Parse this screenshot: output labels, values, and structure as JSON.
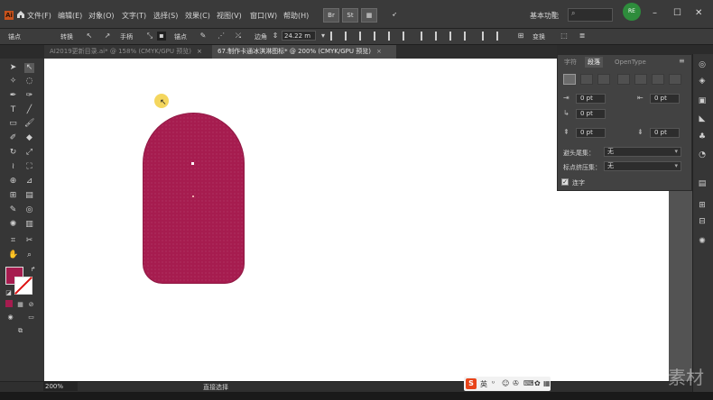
{
  "menubar": {
    "logo": "Ai",
    "items": [
      "文件(F)",
      "编辑(E)",
      "对象(O)",
      "文字(T)",
      "选择(S)",
      "效果(C)",
      "视图(V)",
      "窗口(W)",
      "帮助(H)"
    ],
    "bridge_icon": "Br",
    "stock_icon": "St",
    "workspace": "基本功能",
    "profile_label": "RE"
  },
  "control": {
    "label_anchor": "锚点",
    "label_convert": "转换",
    "label_handle": "手柄",
    "label_anchor_pt": "锚点",
    "label_corner": "边角",
    "corner_radius": "24.22 m",
    "label_transform": "变换"
  },
  "tabs": [
    {
      "label": "AI2019更新目录.ai* @ 158% (CMYK/GPU 预览)",
      "close": "×"
    },
    {
      "label": "67.制作卡通冰淇淋图标* @ 200% (CMYK/GPU 预览)",
      "close": "×"
    }
  ],
  "panel": {
    "tab_character": "字符",
    "tab_paragraph": "段落",
    "tab_opentype": "OpenType",
    "left_indent": "0 pt",
    "right_indent": "0 pt",
    "first_line_indent": "0 pt",
    "space_before": "0 pt",
    "space_after": "0 pt",
    "kinsoku_label": "避头尾集：",
    "kinsoku_value": "无",
    "mojikumi_label": "标点挤压集：",
    "mojikumi_value": "无",
    "hyphenate_label": "连字"
  },
  "status": {
    "zoom": "200%",
    "tool": "直接选择"
  },
  "ime": {
    "logo": "S",
    "lang": "英"
  },
  "watermark": "素材",
  "colors": {
    "shape_fill": "#a61c4f",
    "accent": "#c8521c"
  },
  "icons": {
    "home": "home-icon",
    "selection": "selection-tool-icon",
    "direct_selection": "direct-selection-tool-icon",
    "pen": "pen-tool-icon",
    "type": "type-tool-icon",
    "rectangle": "rectangle-tool-icon",
    "hand": "hand-tool-icon",
    "zoom": "zoom-tool-icon"
  }
}
